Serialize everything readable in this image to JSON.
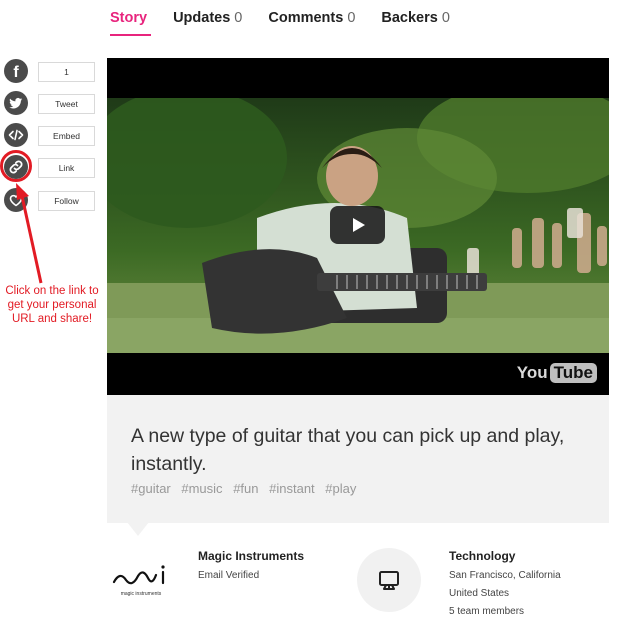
{
  "tabs": [
    {
      "label": "Story",
      "count": ""
    },
    {
      "label": "Updates",
      "count": "0"
    },
    {
      "label": "Comments",
      "count": "0"
    },
    {
      "label": "Backers",
      "count": "0"
    }
  ],
  "share": {
    "facebook": {
      "icon": "facebook-icon",
      "label": "1"
    },
    "twitter": {
      "icon": "twitter-icon",
      "label": "Tweet"
    },
    "embed": {
      "icon": "code-icon",
      "label": "Embed"
    },
    "link": {
      "icon": "link-icon",
      "label": "Link"
    },
    "follow": {
      "icon": "heart-icon",
      "label": "Follow"
    }
  },
  "callout": "Click on the link to get your personal URL and share!",
  "video": {
    "logo_you": "You",
    "logo_tube": "Tube"
  },
  "project": {
    "headline": "A new type of guitar that you can pick up and play, instantly.",
    "tags": [
      "#guitar",
      "#music",
      "#fun",
      "#instant",
      "#play"
    ]
  },
  "creator": {
    "logo_caption": "magic instruments",
    "name": "Magic Instruments",
    "status": "Email Verified"
  },
  "category": {
    "icon": "monitor-icon",
    "title": "Technology",
    "location": "San Francisco, California",
    "country": "United States",
    "team": "5 team members"
  },
  "colors": {
    "accent": "#e8247d",
    "annotation": "#e21b24",
    "panel": "#f2f2f2"
  }
}
